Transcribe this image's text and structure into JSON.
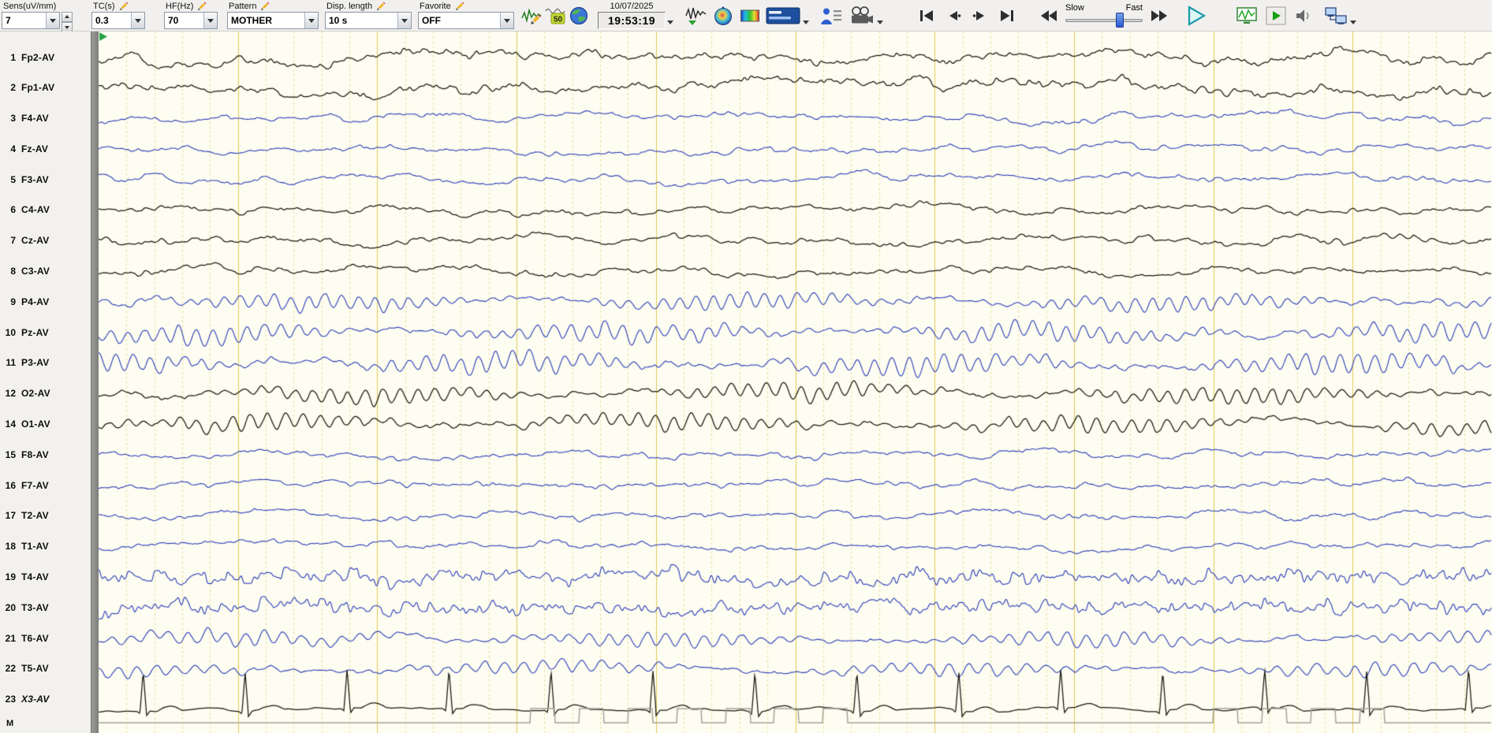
{
  "toolbar": {
    "fields": [
      {
        "label": "Sens(uV/mm)",
        "value": "7"
      },
      {
        "label": "TC(s)",
        "value": "0.3"
      },
      {
        "label": "HF(Hz)",
        "value": "70"
      },
      {
        "label": "Pattern",
        "value": "MOTHER"
      },
      {
        "label": "Disp. length",
        "value": "10 s"
      },
      {
        "label": "Favorite",
        "value": "OFF"
      }
    ],
    "notch_badge": "50",
    "date": "10/07/2025",
    "time": "19:53:19",
    "slider": {
      "slow_label": "Slow",
      "fast_label": "Fast",
      "position": 0.74
    }
  },
  "sidebar": {
    "marker_label": "M"
  },
  "channels": [
    {
      "num": "1",
      "label": "Fp2-AV",
      "color": "black",
      "profile": "frontal",
      "amp": 13,
      "seed": 101
    },
    {
      "num": "2",
      "label": "Fp1-AV",
      "color": "black",
      "profile": "frontal",
      "amp": 13,
      "seed": 102
    },
    {
      "num": "3",
      "label": "F4-AV",
      "color": "blue",
      "profile": "mixed",
      "amp": 10,
      "seed": 103
    },
    {
      "num": "4",
      "label": "Fz-AV",
      "color": "blue",
      "profile": "mixed",
      "amp": 9,
      "seed": 104
    },
    {
      "num": "5",
      "label": "F3-AV",
      "color": "blue",
      "profile": "mixed",
      "amp": 10,
      "seed": 105
    },
    {
      "num": "6",
      "label": "C4-AV",
      "color": "black",
      "profile": "mixed",
      "amp": 10,
      "seed": 106
    },
    {
      "num": "7",
      "label": "Cz-AV",
      "color": "black",
      "profile": "mixed",
      "amp": 11,
      "seed": 107
    },
    {
      "num": "8",
      "label": "C3-AV",
      "color": "black",
      "profile": "mixed",
      "amp": 10,
      "seed": 108
    },
    {
      "num": "9",
      "label": "P4-AV",
      "color": "blue",
      "profile": "alpha",
      "amp": 11,
      "seed": 109
    },
    {
      "num": "10",
      "label": "Pz-AV",
      "color": "blue",
      "profile": "alpha",
      "amp": 13,
      "seed": 110
    },
    {
      "num": "11",
      "label": "P3-AV",
      "color": "blue",
      "profile": "alpha",
      "amp": 14,
      "seed": 111
    },
    {
      "num": "12",
      "label": "O2-AV",
      "color": "black",
      "profile": "alpha",
      "amp": 11,
      "seed": 112
    },
    {
      "num": "14",
      "label": "O1-AV",
      "color": "black",
      "profile": "alpha",
      "amp": 11,
      "seed": 113
    },
    {
      "num": "15",
      "label": "F8-AV",
      "color": "blue",
      "profile": "mixed",
      "amp": 9,
      "seed": 114
    },
    {
      "num": "16",
      "label": "F7-AV",
      "color": "blue",
      "profile": "mixed",
      "amp": 9,
      "seed": 115
    },
    {
      "num": "17",
      "label": "T2-AV",
      "color": "blue",
      "profile": "mixed",
      "amp": 9,
      "seed": 116
    },
    {
      "num": "18",
      "label": "T1-AV",
      "color": "blue",
      "profile": "mixed",
      "amp": 9,
      "seed": 117
    },
    {
      "num": "19",
      "label": "T4-AV",
      "color": "blue",
      "profile": "temporal",
      "amp": 12,
      "seed": 118
    },
    {
      "num": "20",
      "label": "T3-AV",
      "color": "blue",
      "profile": "temporal",
      "amp": 11,
      "seed": 119
    },
    {
      "num": "21",
      "label": "T6-AV",
      "color": "blue",
      "profile": "alpha",
      "amp": 10,
      "seed": 120
    },
    {
      "num": "22",
      "label": "T5-AV",
      "color": "blue",
      "profile": "alpha",
      "amp": 9,
      "seed": 121
    },
    {
      "num": "23",
      "label": "X3-AV",
      "color": "black",
      "profile": "ecg",
      "amp": 50,
      "seed": 122,
      "italic": true
    }
  ],
  "trace_area": {
    "display_seconds": 10,
    "bg": "#fdfdf1",
    "grid_major_color": "#e2cb55",
    "grid_minor_color": "#ece0a2",
    "trace_black": "#17170f",
    "trace_blue": "#2a3bb8",
    "marker_color": "#a6a49a",
    "marker_segments": [
      [
        3.1,
        5.5
      ],
      [
        8.0,
        9.35
      ]
    ],
    "marker_period_s": 0.35,
    "ecg_bpm": 82,
    "start_flag_color": "#27a347"
  }
}
